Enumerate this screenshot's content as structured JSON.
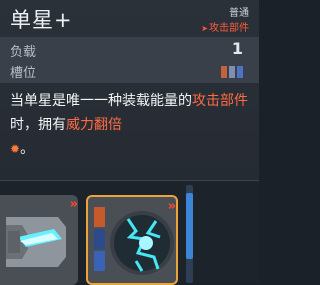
{
  "tooltip": {
    "title": "单星+",
    "rarity": "普通",
    "category": "攻击部件",
    "category_arrow": "➤",
    "stats": {
      "load_label": "负载",
      "load_value": "1",
      "slot_label": "槽位",
      "slot_colors": [
        "#c3623d",
        "#7e8fb3",
        "#4e72c4"
      ]
    },
    "description": {
      "part1": "当单星是唯一一种装载能量的",
      "part2_hl": "攻击部件",
      "part3": "时，拥有",
      "part4_hl": "威力翻倍",
      "part5_icon": "✹",
      "part6": "。"
    }
  },
  "inventory": {
    "card1": {
      "icon": "cyan-crystal-icon",
      "chevron": "»"
    },
    "card2": {
      "icon": "cracked-orb-icon",
      "chevron": "»",
      "selected": true,
      "swatches": [
        "#c65a2a",
        "#2c4a8c",
        "#3a63b8"
      ]
    }
  }
}
